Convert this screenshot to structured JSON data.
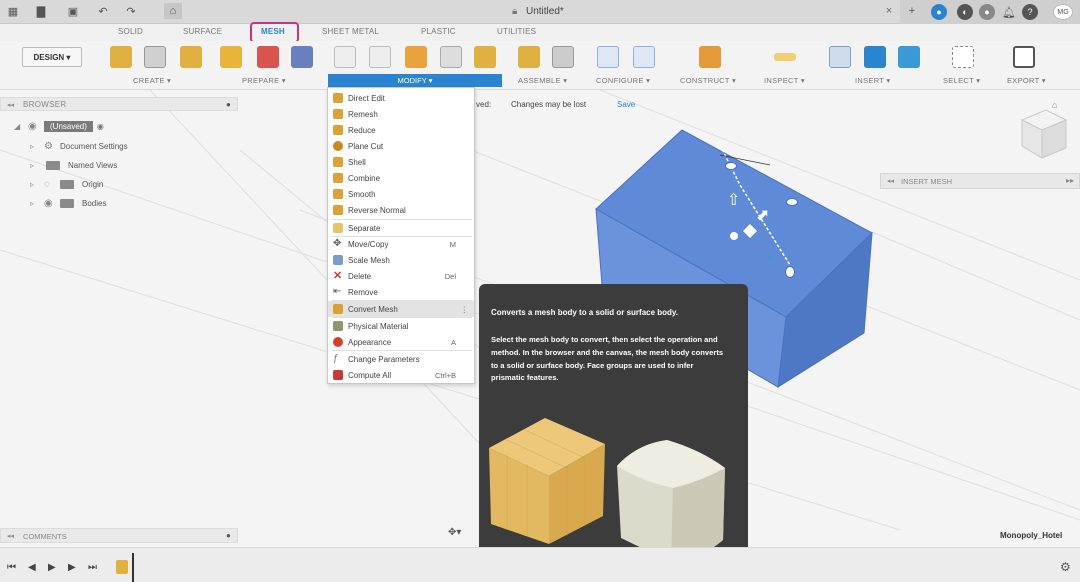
{
  "window": {
    "doc_title": "Untitled*",
    "user_initials": "MG",
    "bottom_doc_name": "Monopoly_Hotel"
  },
  "tabs": [
    {
      "label": "SOLID"
    },
    {
      "label": "SURFACE"
    },
    {
      "label": "MESH",
      "active": true
    },
    {
      "label": "SHEET METAL"
    },
    {
      "label": "PLASTIC"
    },
    {
      "label": "UTILITIES"
    }
  ],
  "ribbon": {
    "workspace": "DESIGN ▾",
    "groups": [
      "CREATE ▾",
      "PREPARE ▾",
      "MODIFY ▾",
      "ASSEMBLE ▾",
      "CONFIGURE ▾",
      "CONSTRUCT ▾",
      "INSPECT ▾",
      "INSERT ▾",
      "SELECT ▾",
      "EXPORT ▾"
    ]
  },
  "browser": {
    "title": "BROWSER",
    "root": "(Unsaved)",
    "items": [
      "Document Settings",
      "Named Views",
      "Origin",
      "Bodies"
    ]
  },
  "info": {
    "unsaved": "ved:",
    "changes": "Changes may be lost",
    "save": "Save"
  },
  "insert_mesh_panel": "INSERT MESH",
  "menu": {
    "items": [
      {
        "label": "Direct Edit",
        "shortcut": "",
        "color": "#d9a233"
      },
      {
        "label": "Remesh",
        "shortcut": "",
        "color": "#d9a233"
      },
      {
        "label": "Reduce",
        "shortcut": "",
        "color": "#d9a233"
      },
      {
        "label": "Plane Cut",
        "shortcut": "",
        "color": "#c98a1e"
      },
      {
        "label": "Shell",
        "shortcut": "",
        "color": "#d9a233"
      },
      {
        "label": "Combine",
        "shortcut": "",
        "color": "#d9a233"
      },
      {
        "label": "Smooth",
        "shortcut": "",
        "color": "#d9a233"
      },
      {
        "label": "Reverse Normal",
        "shortcut": "",
        "color": "#d9a233"
      },
      {
        "label": "Separate",
        "shortcut": "",
        "color": "#e6c56a"
      },
      {
        "label": "Move/Copy",
        "shortcut": "M",
        "color": "#555555"
      },
      {
        "label": "Scale Mesh",
        "shortcut": "",
        "color": "#7a9cc8"
      },
      {
        "label": "Delete",
        "shortcut": "Del",
        "color": "#d23a2a"
      },
      {
        "label": "Remove",
        "shortcut": "",
        "color": "#555555"
      },
      {
        "label": "Convert Mesh",
        "shortcut": "⋮",
        "color": "#d9a233"
      },
      {
        "label": "Physical Material",
        "shortcut": "",
        "color": "#8a9a6a"
      },
      {
        "label": "Appearance",
        "shortcut": "A",
        "color": "#d2442a"
      },
      {
        "label": "Change Parameters",
        "shortcut": "",
        "color": "#777777"
      },
      {
        "label": "Compute All",
        "shortcut": "Ctrl+B",
        "color": "#c83a3a"
      }
    ]
  },
  "tooltip": {
    "title": "Converts a mesh body to a solid or surface body.",
    "body": "Select the mesh body to convert, then select the operation and method. In the browser and the canvas, the mesh body converts to a solid or surface body. Face groups are used to infer prismatic features."
  },
  "comments": "COMMENTS",
  "colors": {
    "accent": "#2a84d0",
    "mesh_body": "#4f7ed1",
    "highlight": "#c8337a",
    "tooltip_bg": "#3c3c3c"
  }
}
